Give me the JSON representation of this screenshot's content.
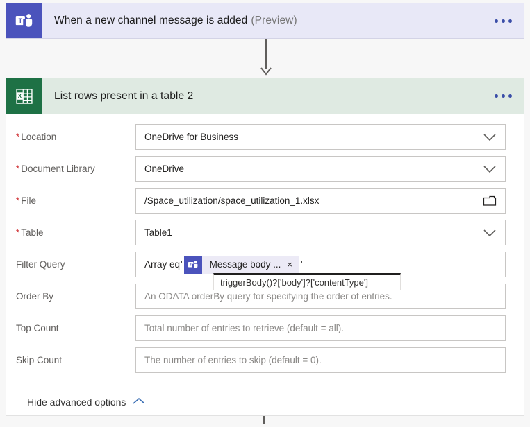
{
  "trigger": {
    "icon": "teams-icon",
    "title": "When a new channel message is added",
    "preview_label": "(Preview)",
    "menu_label": "•••",
    "header_color": "#e8e8f7",
    "icon_color": "#4b53bc"
  },
  "action": {
    "icon": "excel-icon",
    "title": "List rows present in a table 2",
    "menu_label": "•••",
    "header_color": "#dfeae2",
    "icon_color": "#1e7145",
    "fields": [
      {
        "name": "location",
        "label": "Location",
        "required": true,
        "value": "OneDrive for Business",
        "is_placeholder": false,
        "control": "dropdown"
      },
      {
        "name": "document-library",
        "label": "Document Library",
        "required": true,
        "value": "OneDrive",
        "is_placeholder": false,
        "control": "dropdown"
      },
      {
        "name": "file",
        "label": "File",
        "required": true,
        "value": "/Space_utilization/space_utilization_1.xlsx",
        "is_placeholder": false,
        "control": "file-picker"
      },
      {
        "name": "table",
        "label": "Table",
        "required": true,
        "value": "Table1",
        "is_placeholder": false,
        "control": "dropdown"
      }
    ],
    "filter_query": {
      "label": "Filter Query",
      "required": false,
      "prefix_text": "Array eq",
      "open_quote": "'",
      "close_quote": "'",
      "token": {
        "label": "Message body ...",
        "close_label": "×",
        "icon": "teams-icon",
        "icon_color": "#4b53bc",
        "chip_color": "#eceaf6"
      },
      "tooltip": "triggerBody()?['body']?['contentType']"
    },
    "optional_fields": [
      {
        "name": "order-by",
        "label": "Order By",
        "required": false,
        "value": "An ODATA orderBy query for specifying the order of entries.",
        "is_placeholder": true,
        "control": "text"
      },
      {
        "name": "top-count",
        "label": "Top Count",
        "required": false,
        "value": "Total number of entries to retrieve (default = all).",
        "is_placeholder": true,
        "control": "text"
      },
      {
        "name": "skip-count",
        "label": "Skip Count",
        "required": false,
        "value": "The number of entries to skip (default = 0).",
        "is_placeholder": true,
        "control": "text"
      }
    ],
    "advanced_toggle": {
      "label": "Hide advanced options",
      "icon": "chevron-up-icon"
    }
  },
  "colors": {
    "required_star": "#d13438",
    "accent_blue": "#3b4ea8",
    "canvas": "#f7f7f7"
  }
}
